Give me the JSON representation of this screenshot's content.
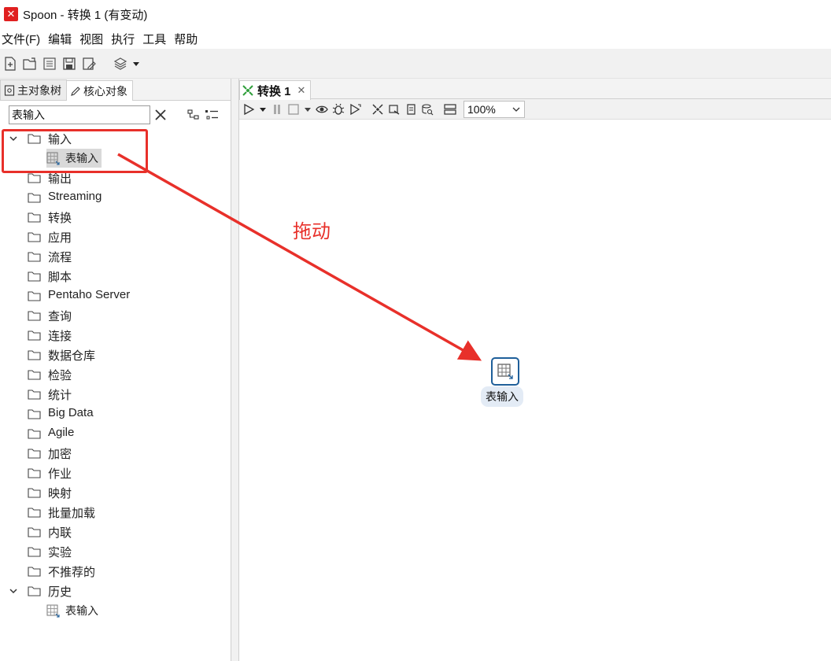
{
  "window": {
    "title": "Spoon - 转换 1 (有变动)"
  },
  "menu": {
    "items": [
      "文件(F)",
      "编辑",
      "视图",
      "执行",
      "工具",
      "帮助"
    ]
  },
  "left_panel": {
    "tabs": [
      {
        "label": "主对象树",
        "icon": "tree-doc-icon"
      },
      {
        "label": "核心对象",
        "icon": "pencil-icon"
      }
    ],
    "search": {
      "value": "表输入",
      "placeholder": ""
    },
    "tree": {
      "input_folder": {
        "label": "输入",
        "expanded": true,
        "child": "表输入"
      },
      "folders": [
        "输出",
        "Streaming",
        "转换",
        "应用",
        "流程",
        "脚本",
        "Pentaho Server",
        "查询",
        "连接",
        "数据仓库",
        "检验",
        "统计",
        "Big Data",
        "Agile",
        "加密",
        "作业",
        "映射",
        "批量加载",
        "内联",
        "实验",
        "不推荐的"
      ],
      "history_folder": {
        "label": "历史",
        "expanded": true,
        "child": "表输入"
      }
    }
  },
  "canvas": {
    "tab_label": "转换 1",
    "zoom": "100%",
    "step": {
      "label": "表输入"
    }
  },
  "annotation": {
    "drag_text": "拖动",
    "color": "#e8302a"
  },
  "colors": {
    "accent": "#1f5f9a",
    "annotation": "#e8302a",
    "toolbar_bg": "#f1f1f1"
  }
}
